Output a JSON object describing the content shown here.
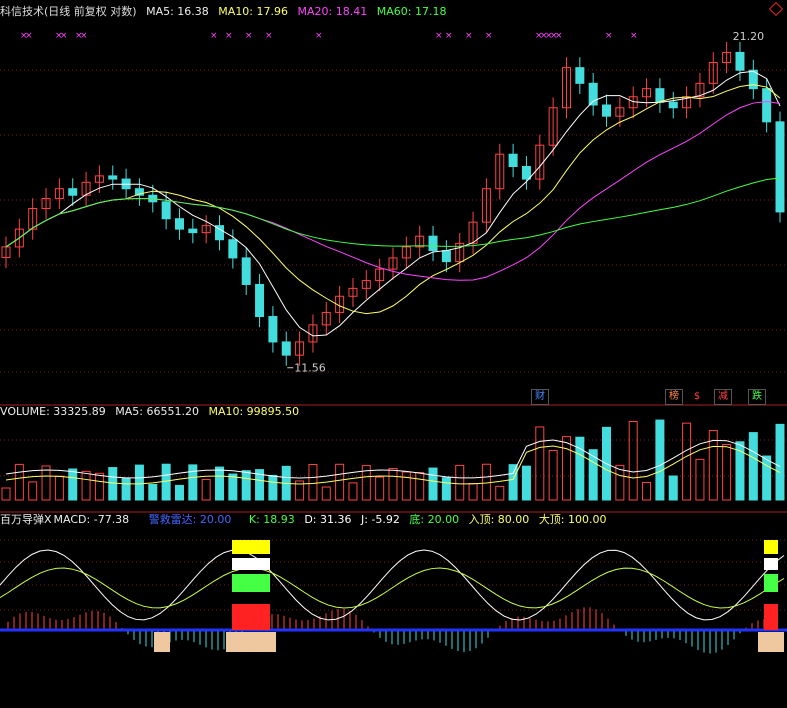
{
  "header": {
    "stock": "科信技术",
    "mode": "(日线 前复权 对数)",
    "ma5": "MA5: 16.38",
    "ma10": "MA10: 17.96",
    "ma20": "MA20: 18.41",
    "ma60": "MA60: 17.18"
  },
  "price": {
    "high_label": "21.20",
    "low_label": "11.56",
    "badges": [
      "财",
      "榜",
      "$",
      "减",
      "跌"
    ]
  },
  "volume": {
    "label": "VOLUME: 33325.89",
    "ma5": "MA5: 66551.20",
    "ma10": "MA10: 99895.50"
  },
  "indicator": {
    "name": "百万导弹X",
    "macd": "MACD: -77.38",
    "alert": "警救雷达: 20.00",
    "k": "K: 18.93",
    "d": "D: 31.36",
    "j": "J: -5.92",
    "bottom": "底: 20.00",
    "entry_top": "入顶: 80.00",
    "big_top": "大顶: 100.00"
  },
  "colors": {
    "ma5": "#ffff66",
    "ma10": "#ffff66",
    "ma20": "#ff44ff",
    "ma60": "#44ff44",
    "up": "#ff4444",
    "down": "#44dddd",
    "blue_line": "#2233ff"
  },
  "chart_data": {
    "type": "line",
    "ylabel": "",
    "xlabel": "",
    "series": [
      {
        "values": [
          14.5,
          15.0,
          15.6,
          15.9,
          16.2,
          16.0,
          16.4,
          16.6,
          16.5,
          16.2,
          16.0,
          15.8,
          15.3,
          15.0,
          14.9,
          15.1,
          14.7,
          14.2,
          13.5,
          12.7,
          12.1,
          11.8,
          12.1,
          12.5,
          12.8,
          13.2,
          13.4,
          13.6,
          13.9,
          14.2,
          14.5,
          14.8,
          14.4,
          14.1,
          14.6,
          15.2,
          16.2,
          17.3,
          16.9,
          16.5,
          17.6,
          18.9,
          20.4,
          19.8,
          19.0,
          18.6,
          18.9,
          19.3,
          19.6,
          19.1,
          18.9,
          19.3,
          19.8,
          20.6,
          21.0,
          20.3,
          19.6,
          18.4,
          15.5
        ]
      }
    ]
  }
}
